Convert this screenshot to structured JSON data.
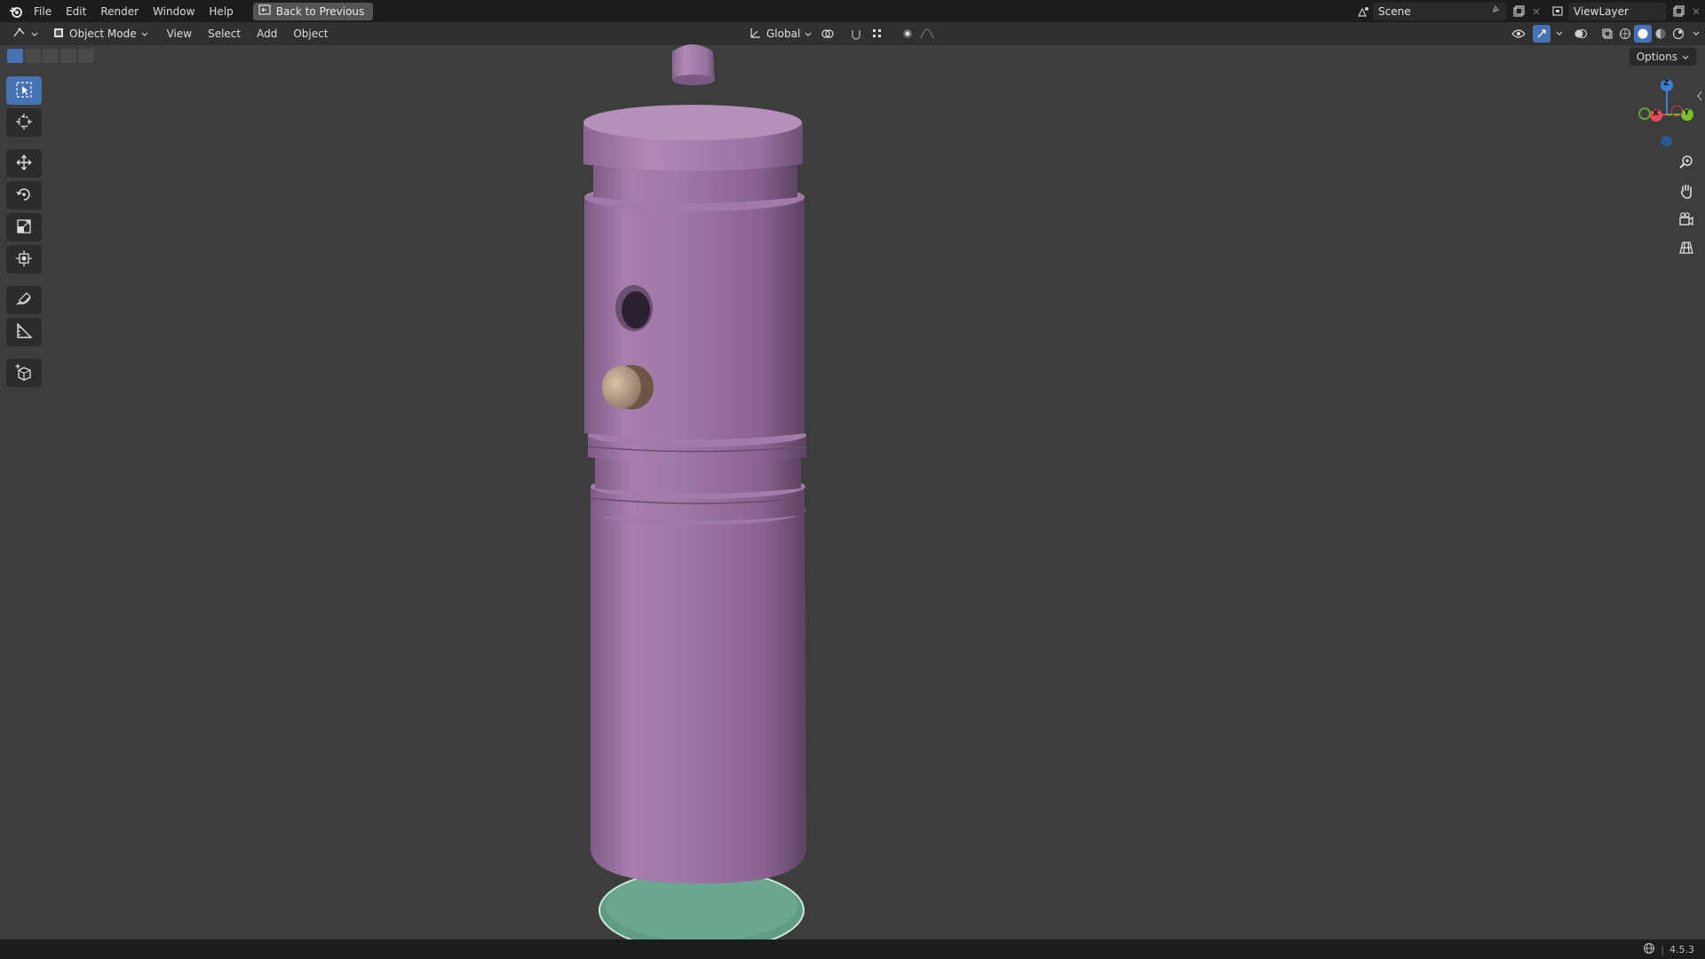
{
  "menu": {
    "file": "File",
    "edit": "Edit",
    "render": "Render",
    "window": "Window",
    "help": "Help",
    "back_to_previous": "Back to Previous"
  },
  "top_right": {
    "scene": "Scene",
    "view_layer": "ViewLayer"
  },
  "header": {
    "mode": "Object Mode",
    "view": "View",
    "select": "Select",
    "add": "Add",
    "object": "Object",
    "orientation": "Global"
  },
  "viewport": {
    "options": "Options"
  },
  "gizmo": {
    "x": "X",
    "y": "Y",
    "z": "Z"
  },
  "status": {
    "version": "4.5.3"
  },
  "colors": {
    "accent": "#4772b3",
    "object_purple": "#9a6f9f",
    "base_green": "#5e9a84",
    "button_tan": "#b39a82"
  }
}
